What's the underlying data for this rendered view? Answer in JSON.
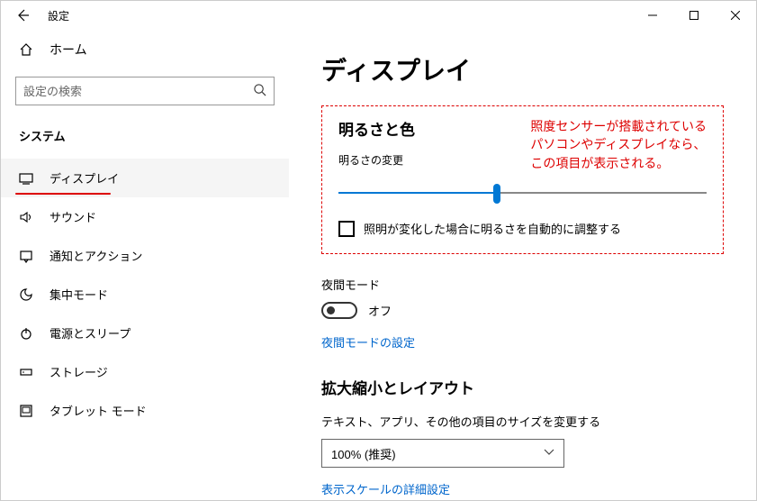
{
  "window": {
    "title": "設定"
  },
  "sidebar": {
    "home": "ホーム",
    "search_placeholder": "設定の検索",
    "section": "システム",
    "items": [
      {
        "label": "ディスプレイ"
      },
      {
        "label": "サウンド"
      },
      {
        "label": "通知とアクション"
      },
      {
        "label": "集中モード"
      },
      {
        "label": "電源とスリープ"
      },
      {
        "label": "ストレージ"
      },
      {
        "label": "タブレット モード"
      }
    ]
  },
  "page": {
    "title": "ディスプレイ",
    "brightness": {
      "heading": "明るさと色",
      "label": "明るさの変更",
      "checkbox_label": "照明が変化した場合に明るさを自動的に調整する"
    },
    "annotation": {
      "line1": "照度センサーが搭載されている",
      "line2": "パソコンやディスプレイなら、",
      "line3": "この項目が表示される。"
    },
    "night": {
      "label": "夜間モード",
      "state": "オフ",
      "link": "夜間モードの設定"
    },
    "scale": {
      "heading": "拡大縮小とレイアウト",
      "desc": "テキスト、アプリ、その他の項目のサイズを変更する",
      "value": "100% (推奨)",
      "link": "表示スケールの詳細設定"
    }
  }
}
